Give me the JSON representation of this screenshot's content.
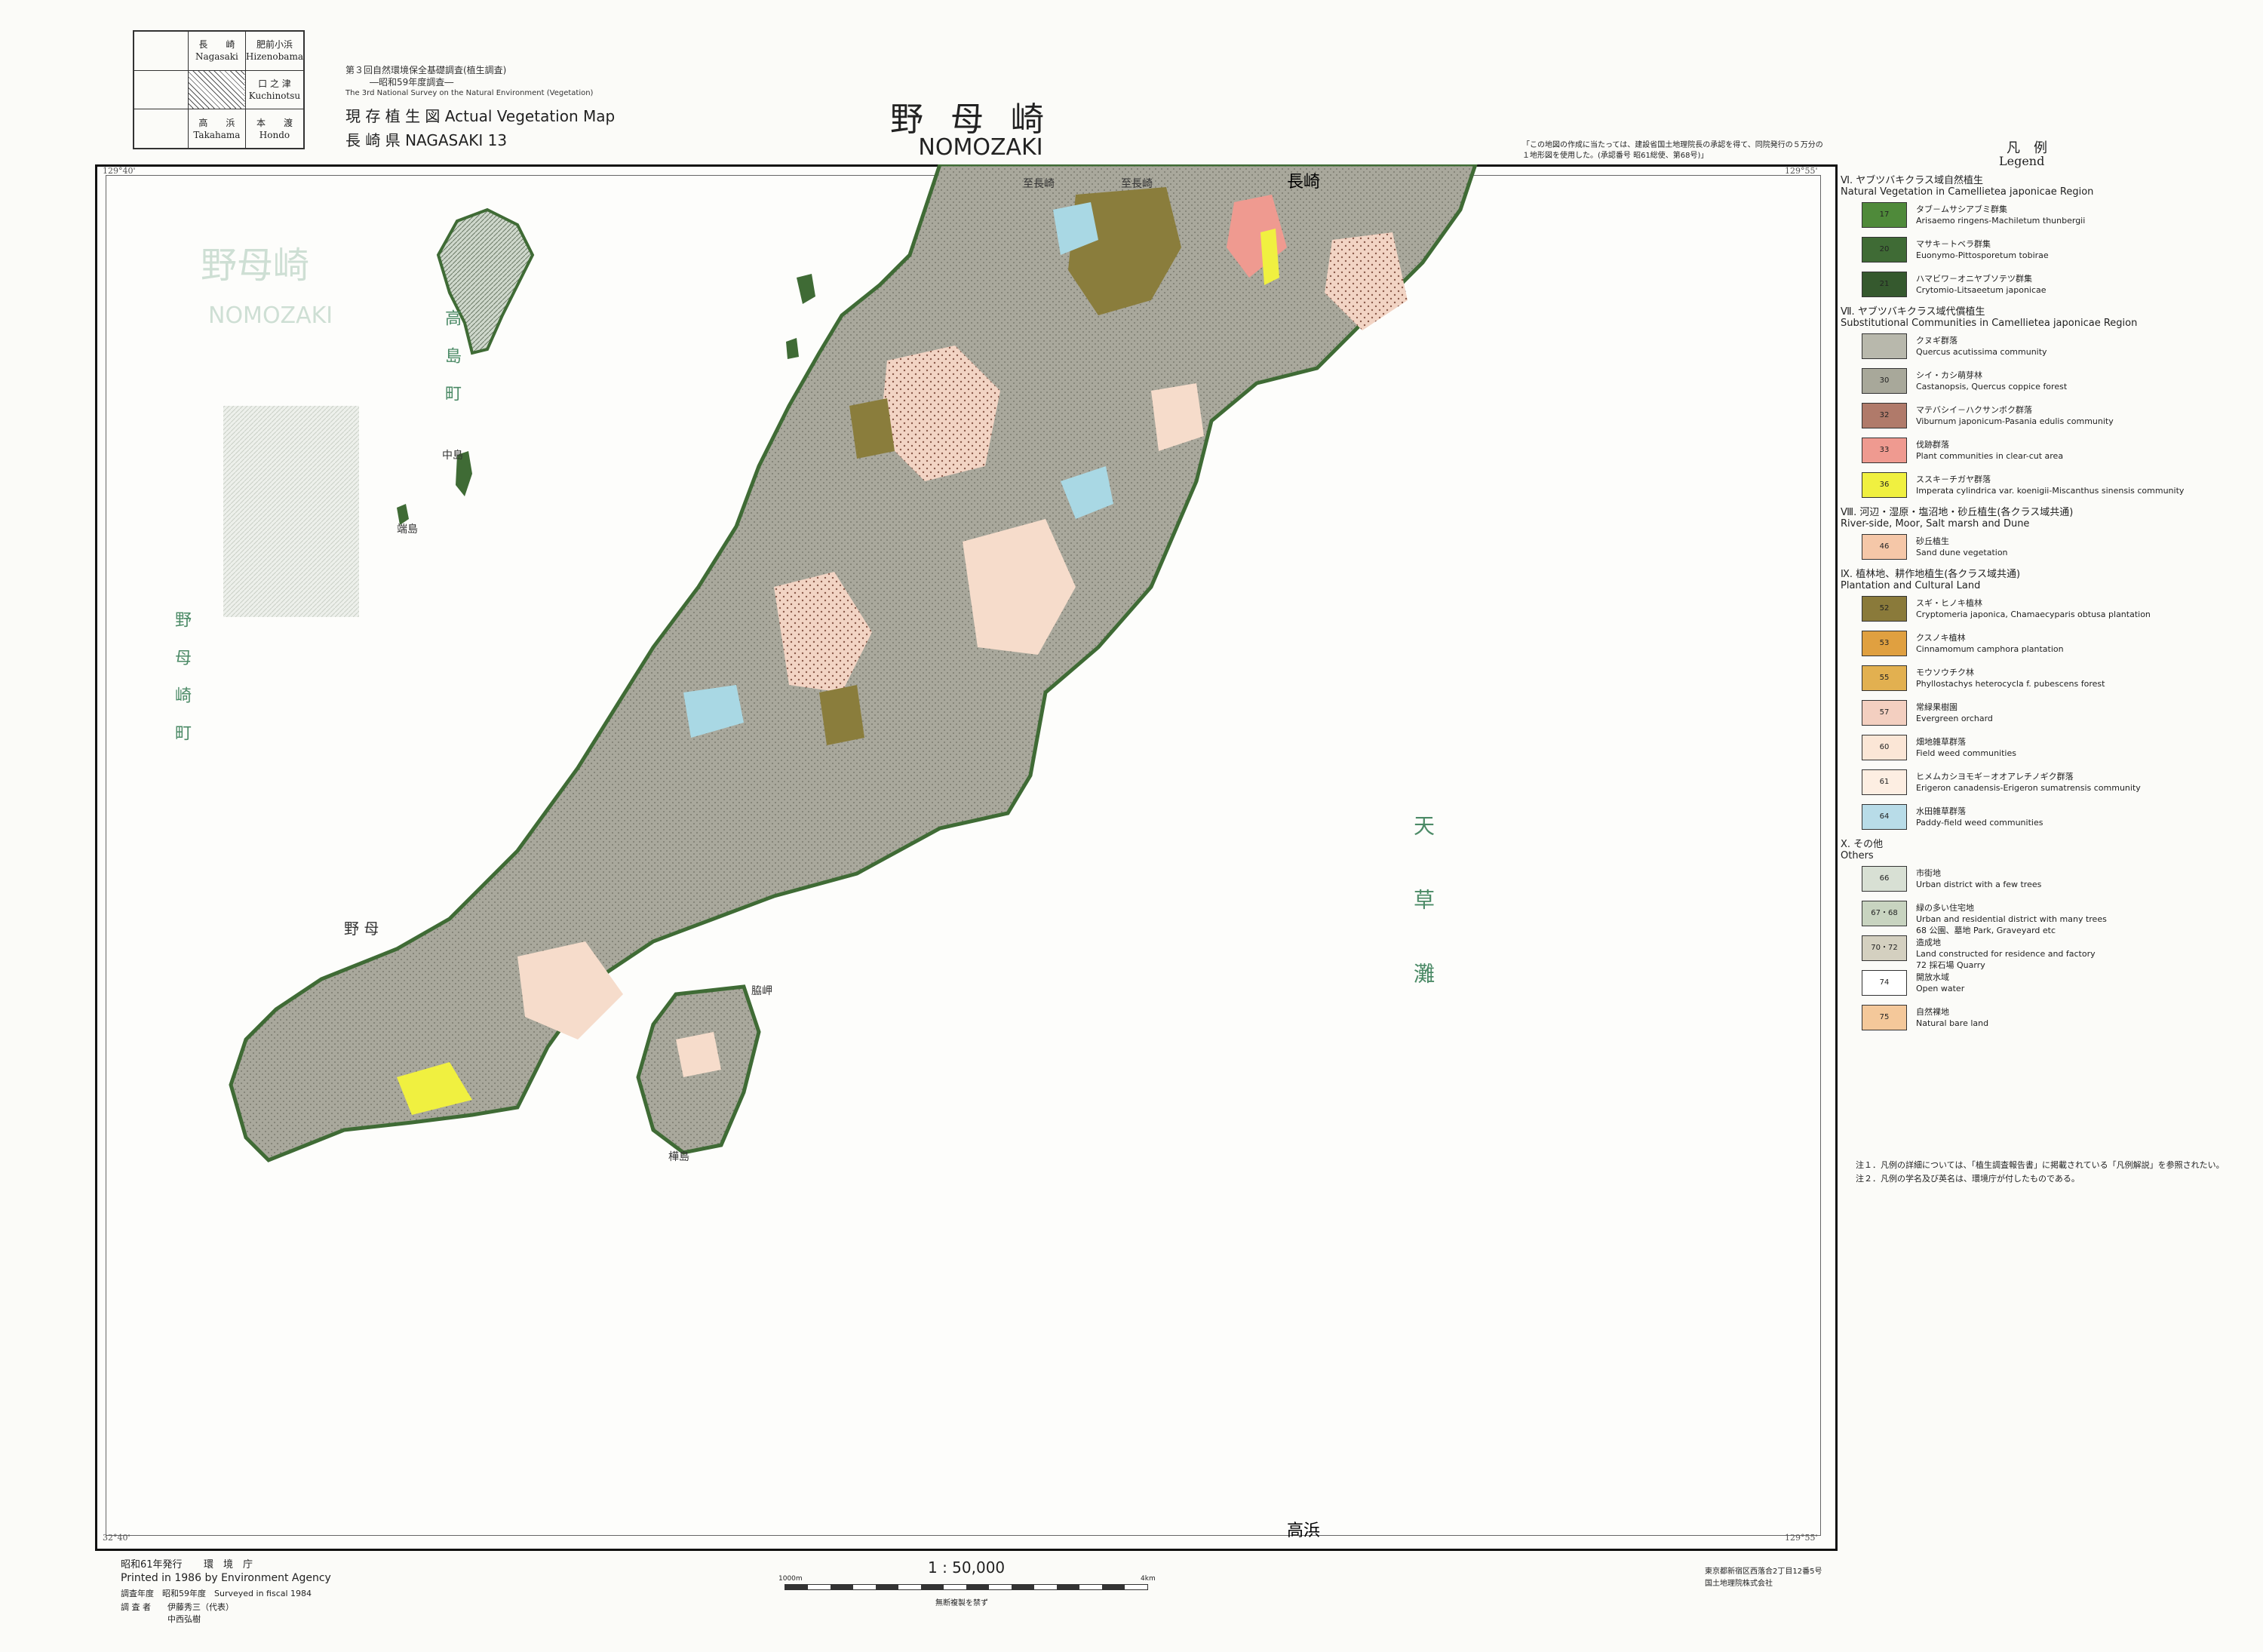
{
  "index_grid": {
    "cells": [
      [
        "",
        "長　　崎\nNagasaki",
        "肥前小浜\nHizenobama"
      ],
      [
        "",
        "",
        "口 之 津\nKuchinotsu"
      ],
      [
        "",
        "高　　浜\nTakahama",
        "本　　渡\nHondo"
      ]
    ]
  },
  "survey": {
    "line1": "第３回自然環境保全基礎調査(植生調査)",
    "line2": "―昭和59年度調査―",
    "line3": "The 3rd National Survey on the Natural Environment (Vegetation)",
    "map_type": "現 存 植 生 図  Actual Vegetation Map",
    "prefecture": "長 崎 県  NAGASAKI 13"
  },
  "title": {
    "jp": "野母崎",
    "en": "NOMOZAKI"
  },
  "map": {
    "labels": {
      "top": "長崎",
      "bottom": "高浜",
      "top_left_a": "至長崎",
      "top_left_b": "至長崎",
      "sea": "天草灘",
      "island": "高島町",
      "town": "野母崎町",
      "nomo": "野 母",
      "faded_title": "野母崎",
      "faded_en": "NOMOZAKI",
      "naka": "中島",
      "hashima": "端島",
      "takahama": "高浜",
      "waki": "脇岬",
      "kabashima": "樺島"
    },
    "coords": {
      "tl": "129°40'",
      "tr": "129°55'",
      "bl": "32°40'",
      "br": "129°55'"
    }
  },
  "legend": {
    "title_jp": "凡　例",
    "title_en": "Legend",
    "credit": "「この地図の作成に当たっては、建設省国土地理院長の承認を得て、同院発行の５万分の１地形図を使用した。(承認番号 昭61総使、第68号)」",
    "sections": [
      {
        "head_jp": "Ⅵ. ヤブツバキクラス域自然植生",
        "head_en": "Natural Vegetation in Camellietea japonicae Region",
        "items": [
          {
            "code": "17",
            "jp": "タブ－ムサシアブミ群集",
            "en": "Arisaemo ringens-Machiletum thunbergii",
            "color": "#4f8a3a"
          },
          {
            "code": "20",
            "jp": "マサキ－トベラ群集",
            "en": "Euonymo-Pittosporetum tobirae",
            "color": "#3f6b35"
          },
          {
            "code": "21",
            "jp": "ハマビワ－オニヤブソテツ群集",
            "en": "Crytomio-Litsaeetum japonicae",
            "color": "#35592e"
          }
        ]
      },
      {
        "head_jp": "Ⅶ. ヤブツバキクラス域代償植生",
        "head_en": "Substitutional Communities in Camellietea japonicae Region",
        "items": [
          {
            "code": "",
            "jp": "クヌギ群落",
            "en": "Quercus acutissima community",
            "color": "#b8b8ac"
          },
          {
            "code": "30",
            "jp": "シイ・カシ萌芽林",
            "en": "Castanopsis, Quercus coppice forest",
            "color": "#a8a89a"
          },
          {
            "code": "32",
            "jp": "マテバシイ－ハクサンボク群落",
            "en": "Viburnum japonicum-Pasania edulis community",
            "color": "#b07a6a"
          },
          {
            "code": "33",
            "jp": "伐跡群落",
            "en": "Plant communities in clear-cut area",
            "color": "#ef9a90"
          },
          {
            "code": "36",
            "jp": "ススキ－チガヤ群落",
            "en": "Imperata cylindrica var. koenigii-Miscanthus sinensis community",
            "color": "#f0f040"
          }
        ]
      },
      {
        "head_jp": "Ⅷ. 河辺・湿原・塩沼地・砂丘植生(各クラス域共通)",
        "head_en": "River-side, Moor, Salt marsh and Dune",
        "items": [
          {
            "code": "46",
            "jp": "砂丘植生",
            "en": "Sand dune vegetation",
            "color": "#f5c7a8"
          }
        ]
      },
      {
        "head_jp": "Ⅸ. 植林地、耕作地植生(各クラス域共通)",
        "head_en": "Plantation and Cultural Land",
        "items": [
          {
            "code": "52",
            "jp": "スギ・ヒノキ植林",
            "en": "Cryptomeria japonica, Chamaecyparis obtusa plantation",
            "color": "#8a7a3a"
          },
          {
            "code": "53",
            "jp": "クスノキ植林",
            "en": "Cinnamomum camphora plantation",
            "color": "#e0a040"
          },
          {
            "code": "55",
            "jp": "モウソウチク林",
            "en": "Phyllostachys heterocycla f. pubescens forest",
            "color": "#e2b050"
          },
          {
            "code": "57",
            "jp": "常緑果樹園",
            "en": "Evergreen orchard",
            "color": "#f3cfc0"
          },
          {
            "code": "60",
            "jp": "畑地雑草群落",
            "en": "Field weed communities",
            "color": "#fbe6d6"
          },
          {
            "code": "61",
            "jp": "ヒメムカシヨモギ－オオアレチノギク群落",
            "en": "Erigeron canadensis-Erigeron sumatrensis community",
            "color": "#fdeee2"
          },
          {
            "code": "64",
            "jp": "水田雑草群落",
            "en": "Paddy-field weed communities",
            "color": "#b8dce8"
          }
        ]
      },
      {
        "head_jp": "Ⅹ. その他",
        "head_en": "Others",
        "items": [
          {
            "code": "66",
            "jp": "市街地",
            "en": "Urban district with a few trees",
            "color": "#d8e0d4"
          },
          {
            "code": "67・68",
            "jp": "緑の多い住宅地",
            "en": "Urban and residential district with many trees",
            "extra": "68 公園、墓地 Park, Graveyard etc",
            "color": "#c8d4c0"
          },
          {
            "code": "70・72",
            "jp": "造成地",
            "en": "Land constructed for residence and factory",
            "extra": "72 採石場 Quarry",
            "color": "#d4d0c0"
          },
          {
            "code": "74",
            "jp": "開放水域",
            "en": "Open water",
            "color": "#ffffff"
          },
          {
            "code": "75",
            "jp": "自然裸地",
            "en": "Natural bare land",
            "color": "#f4c89a"
          }
        ]
      }
    ],
    "notes": [
      "注１．凡例の詳細については、「植生調査報告書」に掲載されている「凡例解説」を参照されたい。",
      "注２．凡例の学名及び英名は、環境庁が付したものである。"
    ]
  },
  "footer": {
    "published": "昭和61年発行",
    "agency_jp": "環　境　庁",
    "printed": "Printed in 1986 by Environment Agency",
    "survey_year": "調査年度　昭和59年度　Surveyed in fiscal 1984",
    "surveyor_label": "調 査 者",
    "surveyor1": "伊藤秀三（代表）",
    "surveyor2": "中西弘樹",
    "scale": "1 : 50,000",
    "scale_left": "1000m",
    "scale_right": "4km",
    "scale_note": "無断複製を禁ず",
    "printer1": "東京都新宿区西落合2丁目12番5号",
    "printer2": "国土地理院株式会社"
  },
  "colors": {
    "water": "#a9d8e4",
    "grey_forest": "#a9a89c",
    "orchard": "#f2d4c4",
    "plantation": "#8a7d3c",
    "natural": "#3f6b35",
    "field": "#f6dccb",
    "label_green": "#4b8a66"
  }
}
